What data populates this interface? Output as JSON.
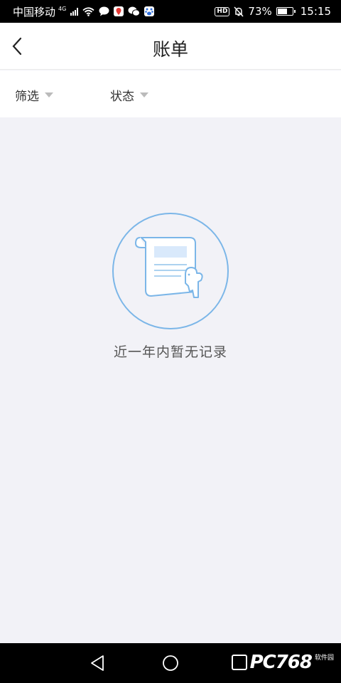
{
  "status_bar": {
    "carrier": "中国移动",
    "network": "4G",
    "battery": "73%",
    "battery_level": 0.73,
    "time": "15:15"
  },
  "header": {
    "title": "账单"
  },
  "filters": [
    {
      "label": "筛选"
    },
    {
      "label": "状态"
    }
  ],
  "empty_state": {
    "message": "近一年内暂无记录"
  },
  "watermark": {
    "text": "PC768",
    "sub": "软件园"
  },
  "colors": {
    "accent_blue": "#7bb6e8",
    "background": "#f2f2f7"
  }
}
